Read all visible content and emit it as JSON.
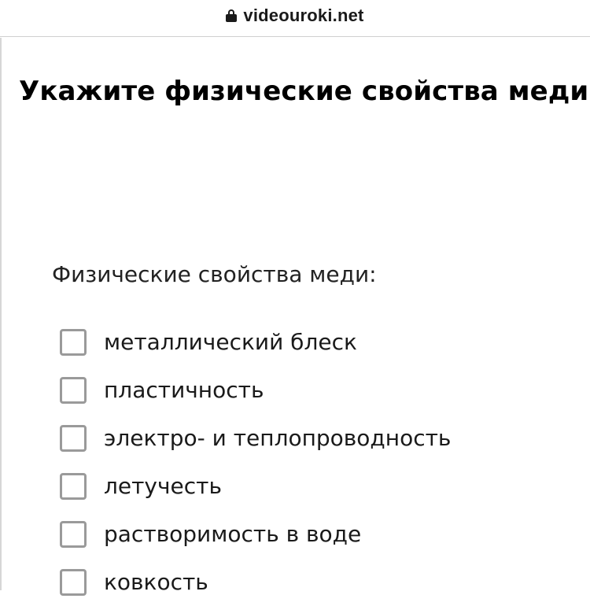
{
  "browser": {
    "url": "videouroki.net",
    "lock_icon": "lock-icon"
  },
  "page": {
    "title": "Укажите физические свойства меди.",
    "question_label": "Физические свойства меди:",
    "options": [
      {
        "label": "металлический блеск",
        "checked": false
      },
      {
        "label": "пластичность",
        "checked": false
      },
      {
        "label": "электро- и теплопроводность",
        "checked": false
      },
      {
        "label": "летучесть",
        "checked": false
      },
      {
        "label": "растворимость в воде",
        "checked": false
      },
      {
        "label": "ковкость",
        "checked": false
      }
    ]
  }
}
